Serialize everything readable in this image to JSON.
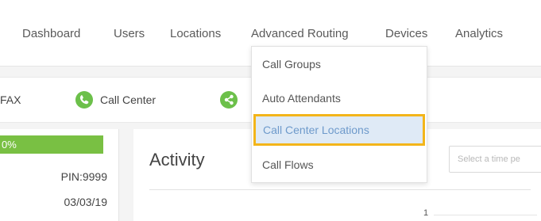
{
  "topnav": {
    "items": [
      "Dashboard",
      "Users",
      "Locations",
      "Advanced Routing",
      "Devices",
      "Analytics"
    ]
  },
  "subbar": {
    "fax_label": "FAX",
    "call_center_label": "Call Center"
  },
  "left_panel": {
    "progress_text": "0%",
    "pin": "PIN:9999",
    "date": "03/03/19"
  },
  "main": {
    "title": "Activity",
    "time_placeholder": "Select a time pe",
    "axis_tick": "1"
  },
  "dropdown": {
    "items": [
      "Call Groups",
      "Auto Attendants",
      "Call Center Locations",
      "Call Flows"
    ],
    "highlighted_index": 2
  },
  "colors": {
    "accent_green": "#6cc04a",
    "highlight_border": "#f3b51a",
    "highlight_bg": "#dfeaf6"
  },
  "icons": {
    "call_center": "phone-icon",
    "second": "share-icon"
  }
}
